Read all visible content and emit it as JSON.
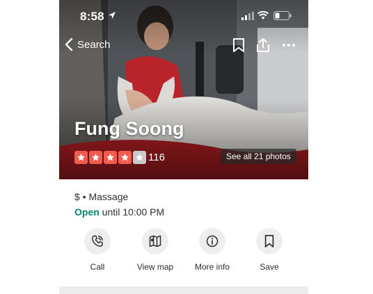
{
  "status_bar": {
    "time": "8:58"
  },
  "nav": {
    "back_label": "Search"
  },
  "business": {
    "name": "Fung Soong",
    "rating": 4,
    "rating_max": 5,
    "review_count": "116",
    "photos_button": "See all 21 photos",
    "price": "$",
    "separator": "•",
    "category": "Massage",
    "open_status": "Open",
    "hours_text": "until 10:00 PM"
  },
  "actions": [
    {
      "label": "Call",
      "icon": "phone-icon"
    },
    {
      "label": "View map",
      "icon": "map-icon"
    },
    {
      "label": "More info",
      "icon": "info-icon"
    },
    {
      "label": "Save",
      "icon": "bookmark-icon"
    }
  ],
  "colors": {
    "star_on": "#f15c4f",
    "star_off": "#c9c9c9",
    "open_green": "#04856b",
    "text_dark": "#2d2e2f",
    "action_circle": "#eeeeef"
  }
}
